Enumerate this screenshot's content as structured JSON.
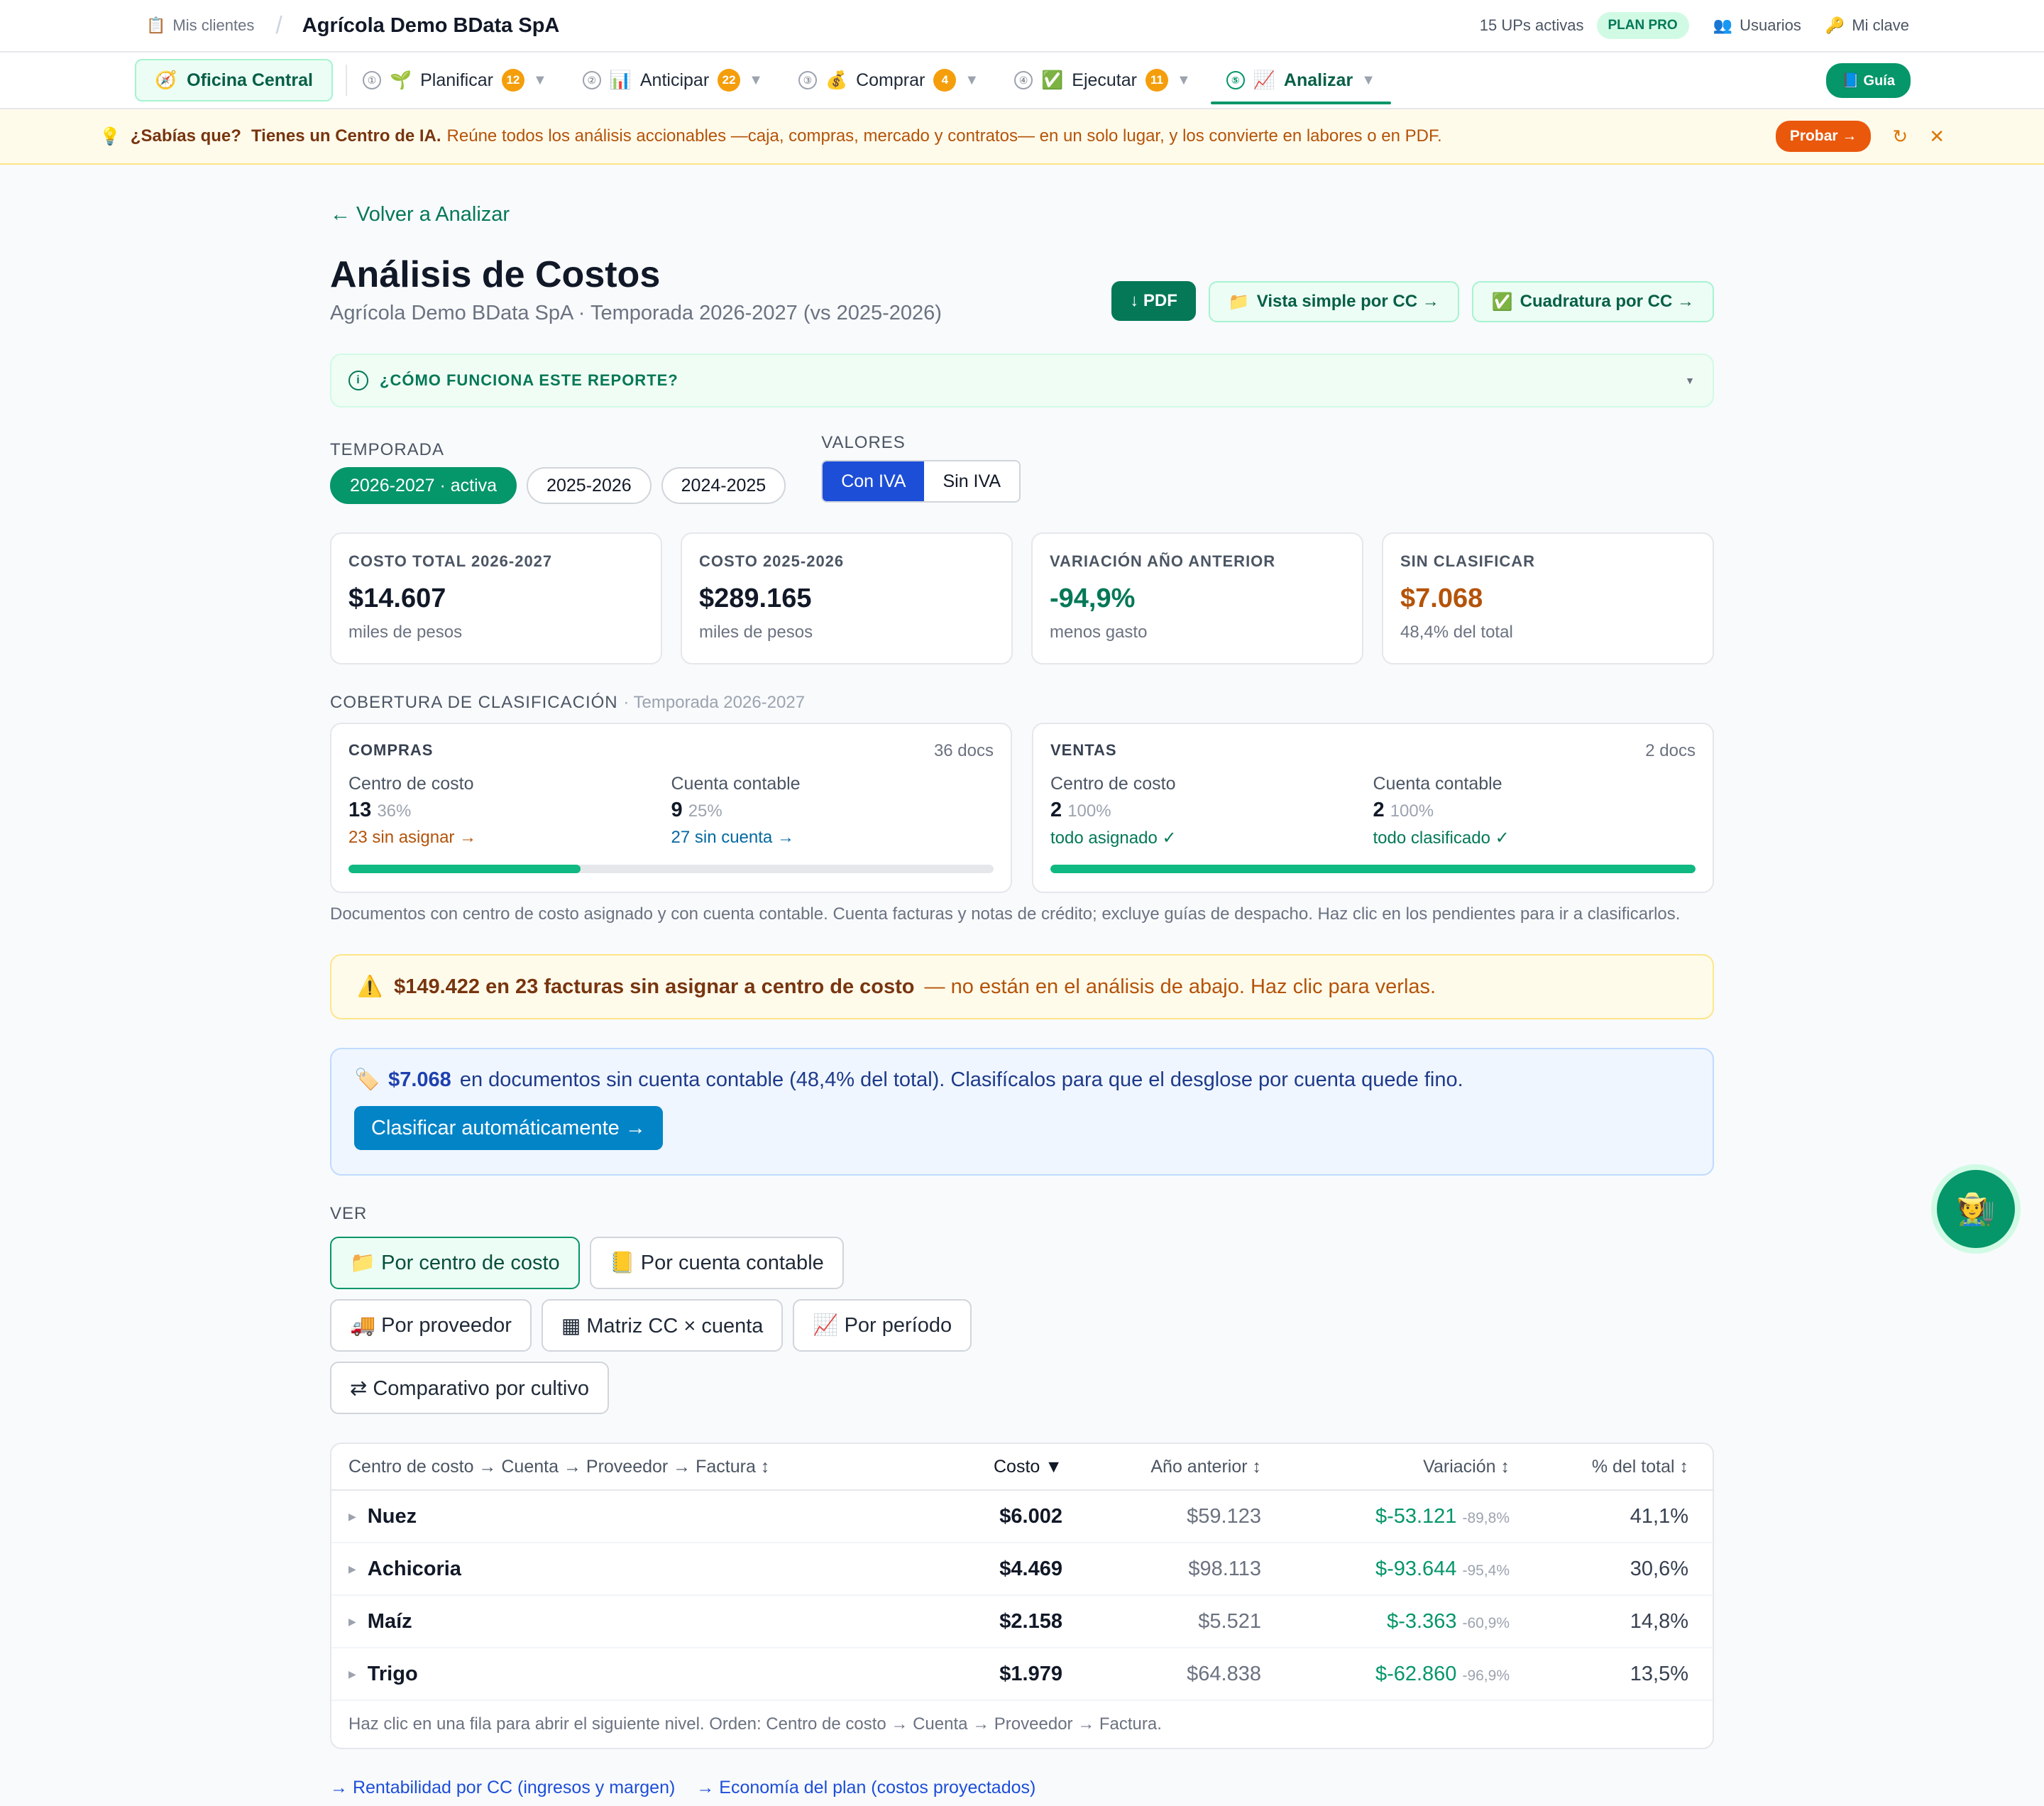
{
  "topbar": {
    "clients_label": "Mis clientes",
    "separator": "/",
    "company": "Agrícola Demo BData SpA",
    "ups_active": "15 UPs activas",
    "plan": "PLAN PRO",
    "users": "Usuarios",
    "key": "Mi clave"
  },
  "nav": {
    "office": "Oficina Central",
    "items": [
      {
        "num": "①",
        "icon": "🌱",
        "label": "Planificar",
        "badge": "12"
      },
      {
        "num": "②",
        "icon": "📊",
        "label": "Anticipar",
        "badge": "22"
      },
      {
        "num": "③",
        "icon": "💰",
        "label": "Comprar",
        "badge": "4"
      },
      {
        "num": "④",
        "icon": "✅",
        "label": "Ejecutar",
        "badge": "11"
      },
      {
        "num": "⑤",
        "icon": "📈",
        "label": "Analizar",
        "badge": ""
      }
    ],
    "guide": "📘 Guía"
  },
  "tip": {
    "question": "¿Sabías que?",
    "headline": "Tienes un Centro de IA.",
    "text": "Reúne todos los análisis accionables —caja, compras, mercado y contratos— en un solo lugar, y los convierte en labores o en PDF.",
    "try": "Probar →"
  },
  "page": {
    "back": "← Volver a Analizar",
    "title": "Análisis de Costos",
    "subtitle": "Agrícola Demo BData SpA · Temporada 2026-2027 (vs 2025-2026)",
    "pdf": "↓ PDF",
    "simple_view": "Vista simple por CC →",
    "reconcile": "Cuadratura por CC →",
    "howto": "¿CÓMO FUNCIONA ESTE REPORTE?"
  },
  "filters": {
    "season_label": "TEMPORADA",
    "seasons": [
      "2026-2027 · activa",
      "2025-2026",
      "2024-2025"
    ],
    "values_label": "VALORES",
    "values": [
      "Con IVA",
      "Sin IVA"
    ]
  },
  "kpis": [
    {
      "label": "COSTO TOTAL 2026-2027",
      "value": "$14.607",
      "sub": "miles de pesos",
      "color": "#111827"
    },
    {
      "label": "COSTO 2025-2026",
      "value": "$289.165",
      "sub": "miles de pesos",
      "color": "#111827"
    },
    {
      "label": "VARIACIÓN AÑO ANTERIOR",
      "value": "-94,9%",
      "sub": "menos gasto",
      "color": "#047857"
    },
    {
      "label": "SIN CLASIFICAR",
      "value": "$7.068",
      "sub": "48,4% del total",
      "color": "#b45309"
    }
  ],
  "coverage": {
    "title": "COBERTURA DE CLASIFICACIÓN",
    "season": "· Temporada 2026-2027",
    "purchases": {
      "label": "COMPRAS",
      "docs": "36 docs",
      "cc_label": "Centro de costo",
      "cc_value": "13",
      "cc_pct": "36%",
      "cc_action": "23 sin asignar →",
      "acc_label": "Cuenta contable",
      "acc_value": "9",
      "acc_pct": "25%",
      "acc_action": "27 sin cuenta →",
      "progress": 0.36
    },
    "sales": {
      "label": "VENTAS",
      "docs": "2 docs",
      "cc_label": "Centro de costo",
      "cc_value": "2",
      "cc_pct": "100%",
      "cc_action": "todo asignado ✓",
      "acc_label": "Cuenta contable",
      "acc_value": "2",
      "acc_pct": "100%",
      "acc_action": "todo clasificado ✓",
      "progress": 1.0
    },
    "note": "Documentos con centro de costo asignado y con cuenta contable. Cuenta facturas y notas de crédito; excluye guías de despacho. Haz clic en los pendientes para ir a clasificarlos."
  },
  "warning": {
    "bold": "$149.422 en 23 facturas sin asignar a centro de costo",
    "text": "— no están en el análisis de abajo. Haz clic para verlas."
  },
  "classify": {
    "amount": "$7.068",
    "text": "en documentos sin cuenta contable (48,4% del total). Clasifícalos para que el desglose por cuenta quede fino.",
    "cta": "Clasificar automáticamente →"
  },
  "views": {
    "label": "VER",
    "items": [
      "📁 Por centro de costo",
      "📒 Por cuenta contable",
      "🚚 Por proveedor",
      "▦ Matriz CC × cuenta",
      "📈 Por período",
      "⇄ Comparativo por cultivo"
    ]
  },
  "table": {
    "headers": [
      "Centro de costo → Cuenta → Proveedor → Factura ↕",
      "Costo ▼",
      "Año anterior ↕",
      "Variación ↕",
      "% del total ↕"
    ],
    "rows": [
      {
        "name": "Nuez",
        "cost": "$6.002",
        "prev": "$59.123",
        "var": "$-53.121",
        "varpct": "-89,8%",
        "share": "41,1%"
      },
      {
        "name": "Achicoria",
        "cost": "$4.469",
        "prev": "$98.113",
        "var": "$-93.644",
        "varpct": "-95,4%",
        "share": "30,6%"
      },
      {
        "name": "Maíz",
        "cost": "$2.158",
        "prev": "$5.521",
        "var": "$-3.363",
        "varpct": "-60,9%",
        "share": "14,8%"
      },
      {
        "name": "Trigo",
        "cost": "$1.979",
        "prev": "$64.838",
        "var": "$-62.860",
        "varpct": "-96,9%",
        "share": "13,5%"
      }
    ],
    "footer": "Haz clic en una fila para abrir el siguiente nivel. Orden: Centro de costo → Cuenta → Proveedor → Factura."
  },
  "links": [
    "→ Rentabilidad por CC (ingresos y margen)",
    "→ Economía del plan (costos proyectados)"
  ]
}
